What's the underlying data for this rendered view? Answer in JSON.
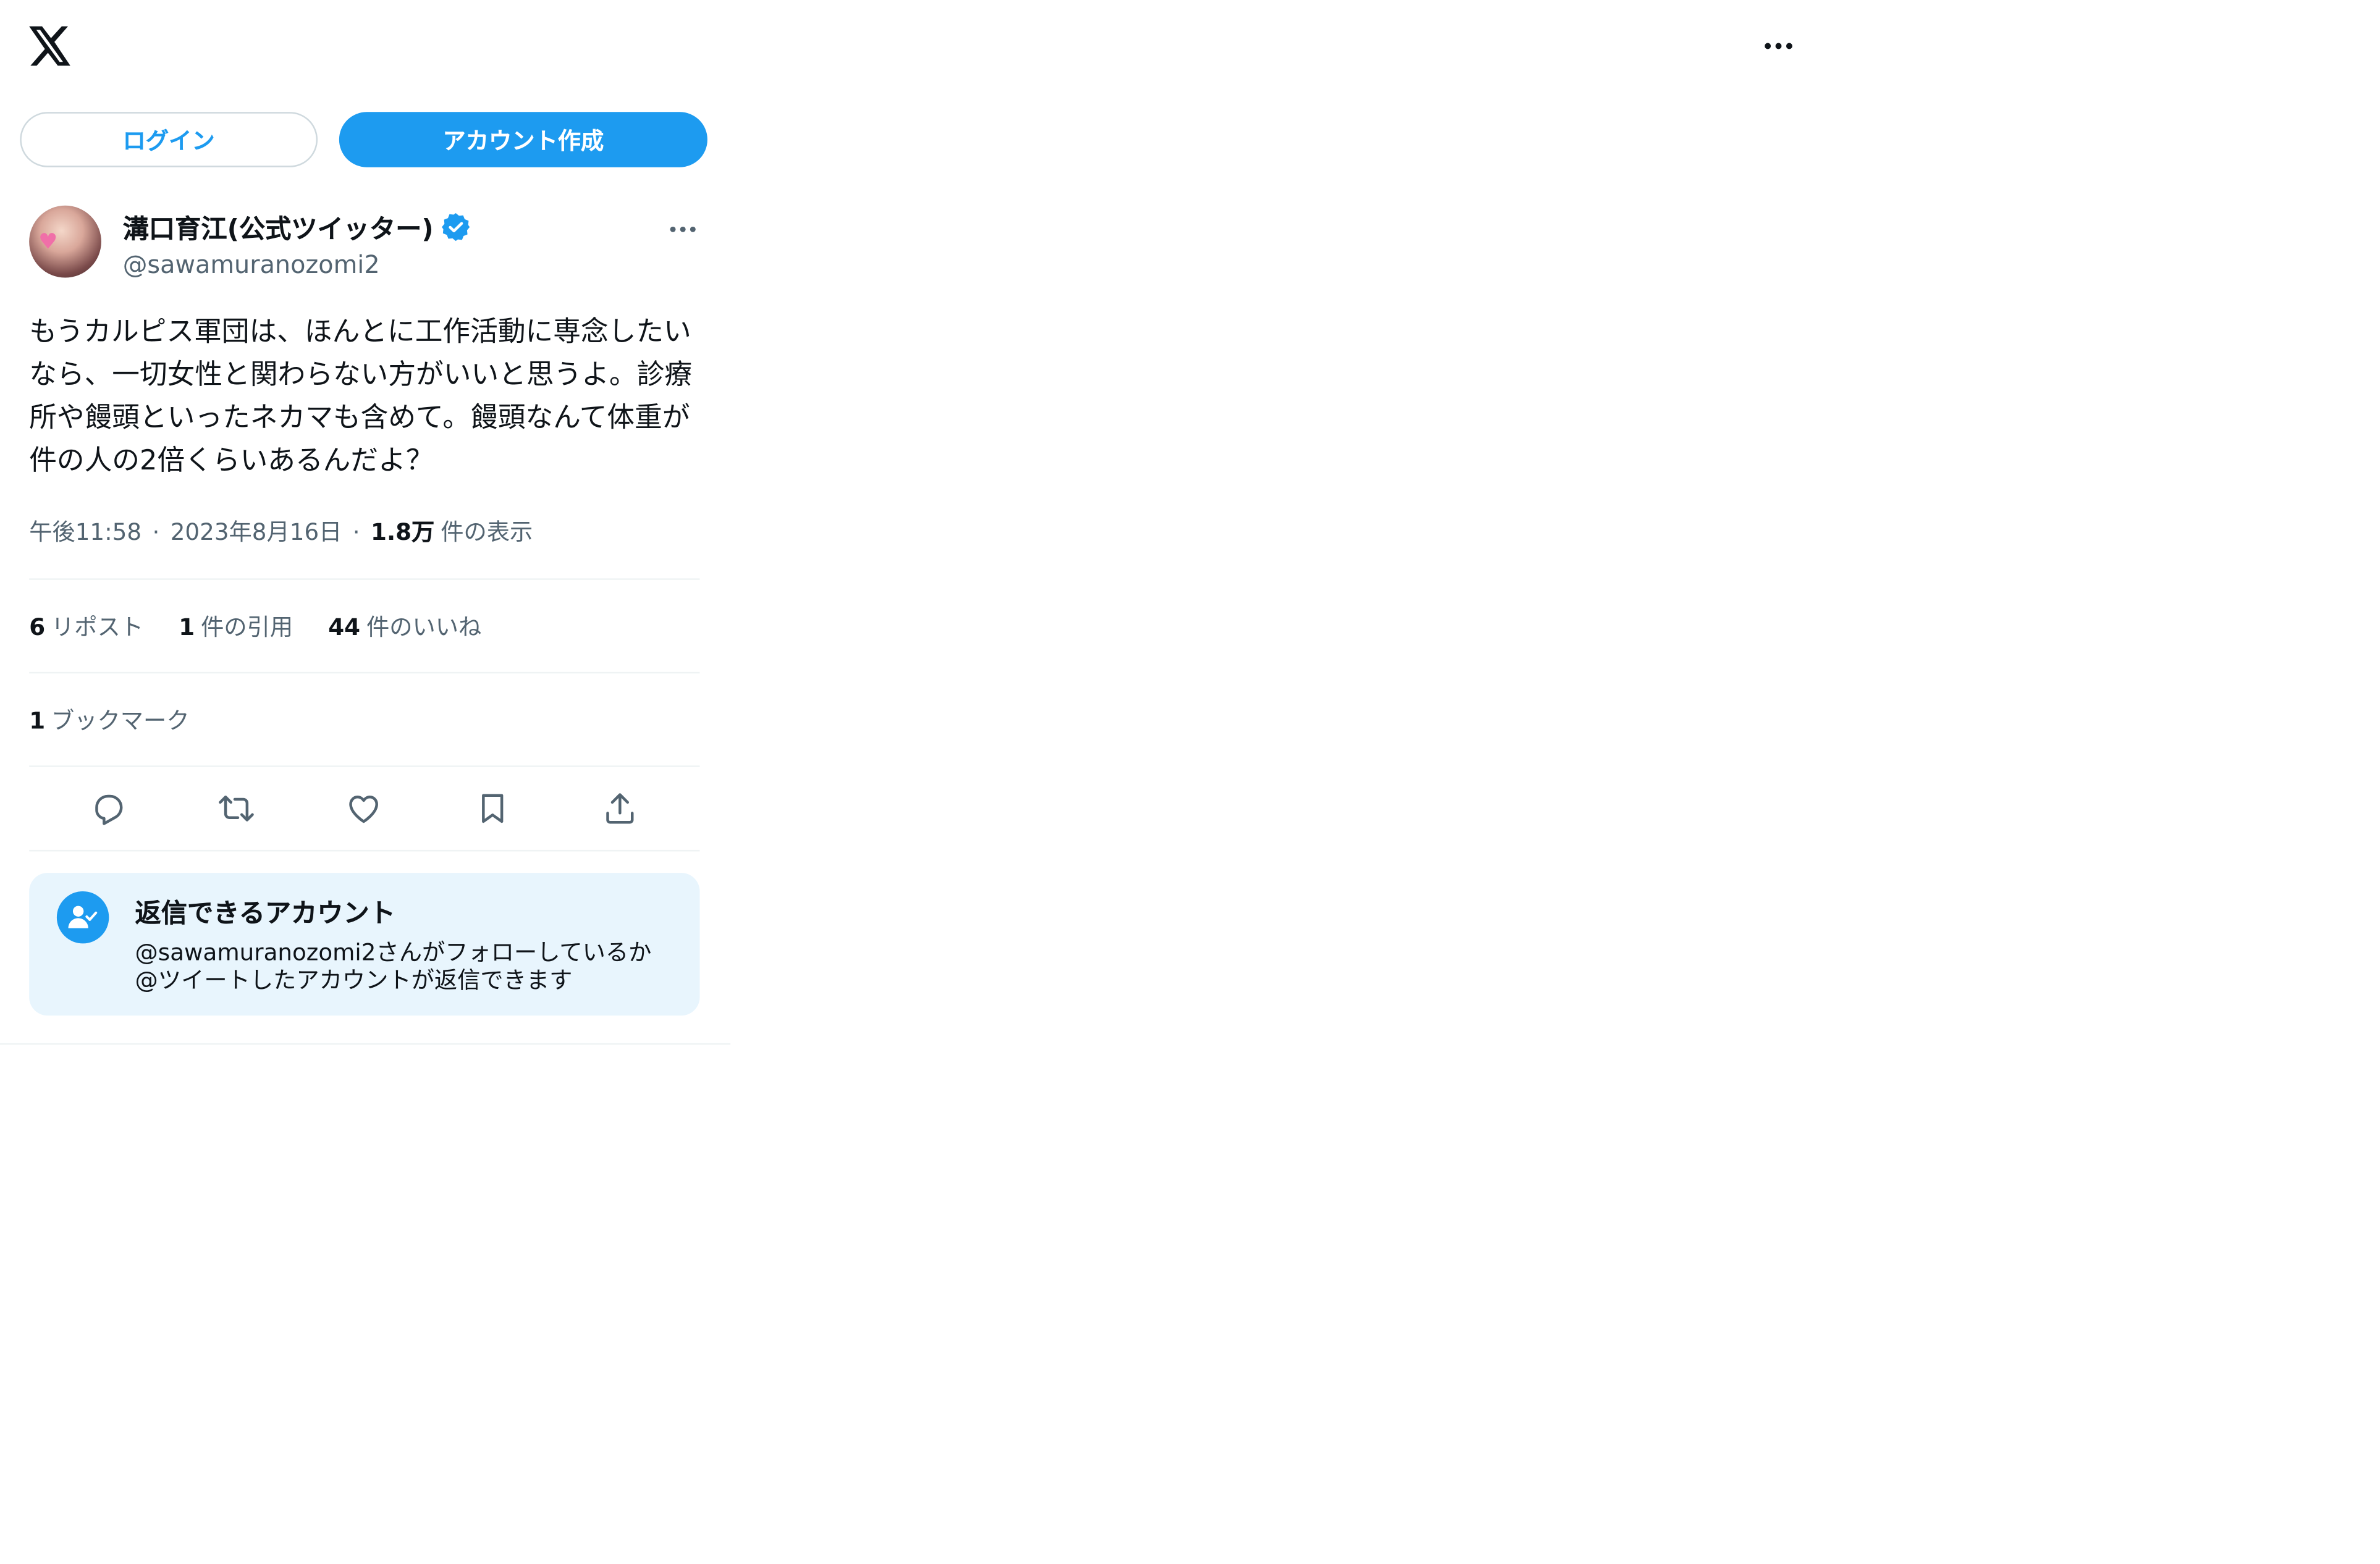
{
  "header": {
    "logo_icon": "x-logo-icon",
    "more_icon": "more-horizontal-icon"
  },
  "auth": {
    "login_label": "ログイン",
    "signup_label": "アカウント作成"
  },
  "tweet": {
    "display_name": "溝口育江(公式ツイッター)",
    "handle": "@sawamuranozomi2",
    "text": "もうカルピス軍団は、ほんとに工作活動に専念したいなら、一切女性と関わらない方がいいと思うよ。診療所や饅頭といったネカマも含めて。饅頭なんて体重が件の人の2倍くらいあるんだよ？",
    "time": "午後11:58",
    "date": "2023年8月16日",
    "separator": "·",
    "views_count": "1.8万",
    "views_label": "件の表示"
  },
  "stats": {
    "reposts_count": "6",
    "reposts_label": "リポスト",
    "quotes_count": "1",
    "quotes_label": "件の引用",
    "likes_count": "44",
    "likes_label": "件のいいね",
    "bookmarks_count": "1",
    "bookmarks_label": "ブックマーク"
  },
  "reply_settings": {
    "title": "返信できるアカウント",
    "line1": "@sawamuranozomi2さんがフォローしているか",
    "line2": "@ツイートしたアカウントが返信できます"
  },
  "colors": {
    "accent": "#1d9bf0",
    "text_primary": "#0f1419",
    "text_secondary": "#536471",
    "reply_box_bg": "#e8f5fd",
    "divider": "#eff3f4"
  }
}
